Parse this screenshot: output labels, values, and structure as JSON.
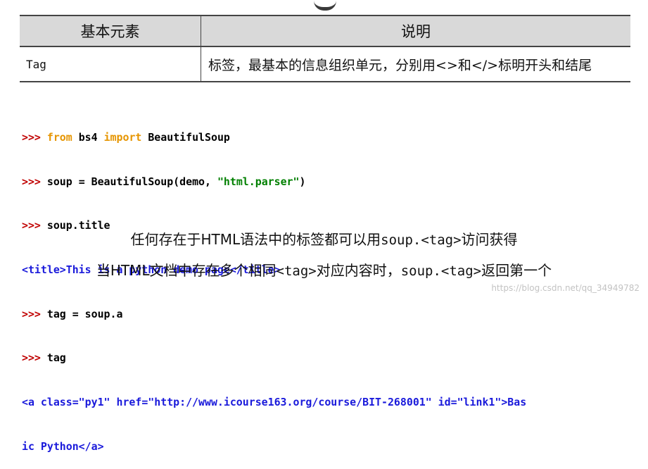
{
  "table": {
    "headers": [
      "基本元素",
      "说明"
    ],
    "rows": [
      {
        "element": "Tag",
        "description": "标签，最基本的信息组织单元，分别用<>和</>标明开头和结尾"
      }
    ]
  },
  "code_lines": [
    {
      "prompt": ">>> ",
      "kw1": "from",
      "t1": " bs4 ",
      "kw2": "import",
      "t2": " BeautifulSoup"
    },
    {
      "prompt": ">>> ",
      "pre": "soup = BeautifulSoup(demo, ",
      "str": "\"html.parser\"",
      "post": ")"
    },
    {
      "prompt": ">>> ",
      "text": "soup.title"
    },
    {
      "output": "<title>This is a python demo page</title>"
    },
    {
      "prompt": ">>> ",
      "text": "tag = soup.a"
    },
    {
      "prompt": ">>> ",
      "text": "tag"
    },
    {
      "output": "<a class=\"py1\" href=\"http://www.icourse163.org/course/BIT-268001\" id=\"link1\">Bas"
    },
    {
      "output": "ic Python</a>"
    }
  ],
  "notes": {
    "line1": {
      "a": "任何存在于HTML语法中的标签都可以用",
      "code": "soup.<tag>",
      "b": "访问获得"
    },
    "line2": {
      "a": "当HTML文档中存在多个相同",
      "code1": "<tag>",
      "b": "对应内容时，",
      "code2": "soup.<tag>",
      "c": "返回第一个"
    }
  },
  "footer": {
    "link": "https://blog.csdn.net/qq_34949782"
  },
  "colors": {
    "prompt": "#c00000",
    "keyword": "#e69500",
    "string": "#008000",
    "output": "#1a1adb",
    "header_bg": "#d9d9d9"
  }
}
